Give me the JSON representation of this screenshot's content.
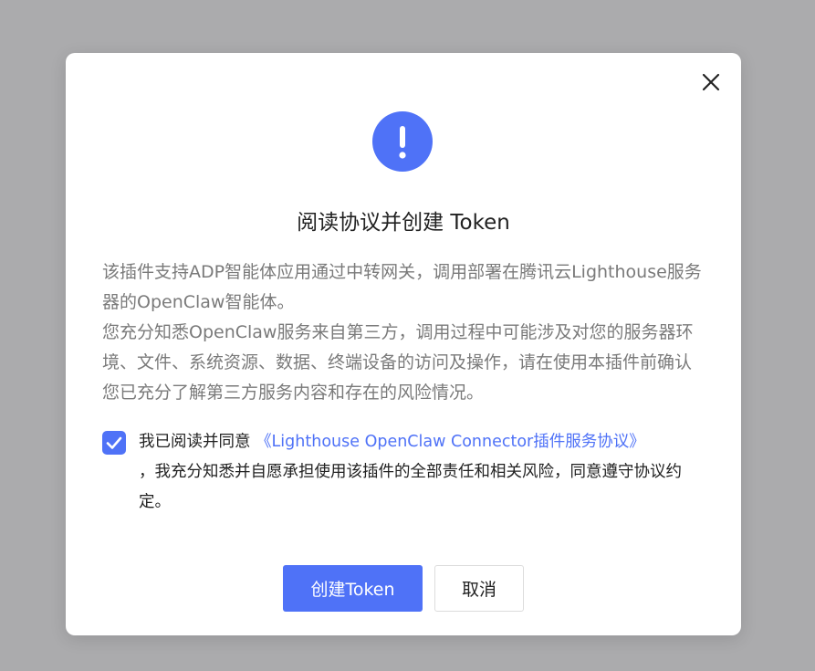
{
  "dialog": {
    "title": "阅读协议并创建 Token",
    "description_lines": [
      "该插件支持ADP智能体应用通过中转网关，调用部署在腾讯云Lighthouse服务器的OpenClaw智能体。",
      "您充分知悉OpenClaw服务来自第三方，调用过程中可能涉及对您的服务器环境、文件、系统资源、数据、终端设备的访问及操作，请在使用本插件前确认您已充分了解第三方服务内容和存在的风险情况。"
    ],
    "agreement": {
      "checked": true,
      "prefix": "我已阅读并同意 ",
      "link_text": "《Lighthouse OpenClaw Connector插件服务协议》",
      "suffix": "，我充分知悉并自愿承担使用该插件的全部责任和相关风险，同意遵守协议约定。"
    },
    "buttons": {
      "confirm_label": "创建Token",
      "cancel_label": "取消"
    },
    "icons": {
      "alert": "exclamation-icon",
      "close": "close-icon",
      "check": "check-icon"
    },
    "colors": {
      "accent": "#4f72f7",
      "overlay": "#ababad",
      "text_primary": "#222222",
      "text_secondary": "#7a7a7a"
    }
  }
}
